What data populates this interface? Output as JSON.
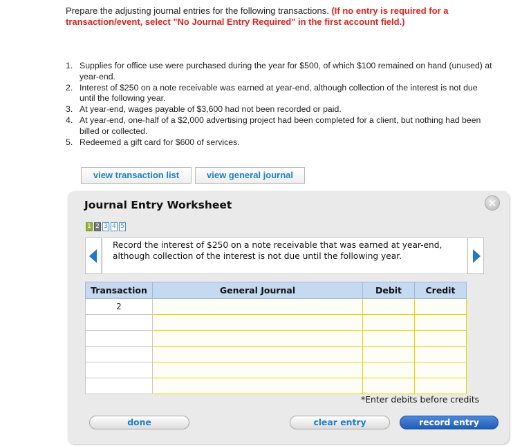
{
  "instructions": {
    "text": "Prepare the adjusting journal entries for the following transactions. ",
    "warning": "(If no entry is required for a transaction/event, select \"No Journal Entry Required\" in the first account field.)"
  },
  "transactions": [
    {
      "num": "1.",
      "text": "Supplies for office use were purchased during the year for $500, of which $100 remained on hand (unused) at year-end."
    },
    {
      "num": "2.",
      "text": "Interest of $250 on a note receivable was earned at year-end, although collection of the interest is not due until the following year."
    },
    {
      "num": "3.",
      "text": "At year-end, wages payable of $3,600 had not been recorded or paid."
    },
    {
      "num": "4.",
      "text": "At year-end, one-half of a $2,000 advertising project had been completed for a client, but nothing had been billed or collected."
    },
    {
      "num": "5.",
      "text": "Redeemed a gift card for $600 of services."
    }
  ],
  "buttons": {
    "view_transaction_list": "view transaction list",
    "view_general_journal": "view general journal",
    "done": "done",
    "clear_entry": "clear entry",
    "record_entry": "record entry"
  },
  "worksheet": {
    "title": "Journal Entry Worksheet",
    "close_icon": "close-icon",
    "close_symbol": "✕",
    "pages": [
      "1",
      "2",
      "3",
      "4",
      "5"
    ],
    "current_page": "2",
    "prompt": "Record the interest of $250 on a note receivable that was earned at year-end, although collection of the interest is not due until the following year.",
    "table": {
      "headers": {
        "transaction": "Transaction",
        "general_journal": "General Journal",
        "debit": "Debit",
        "credit": "Credit"
      },
      "rows": [
        {
          "transaction": "2"
        },
        {
          "transaction": ""
        },
        {
          "transaction": ""
        },
        {
          "transaction": ""
        },
        {
          "transaction": ""
        },
        {
          "transaction": ""
        }
      ]
    },
    "hint": "*Enter debits before credits"
  },
  "colors": {
    "accent_blue": "#1c7fd0",
    "warning_red": "#e0201b",
    "record_button": "#1f5cb6",
    "header_fill": "#c5daf0",
    "input_border": "#e6d600"
  }
}
